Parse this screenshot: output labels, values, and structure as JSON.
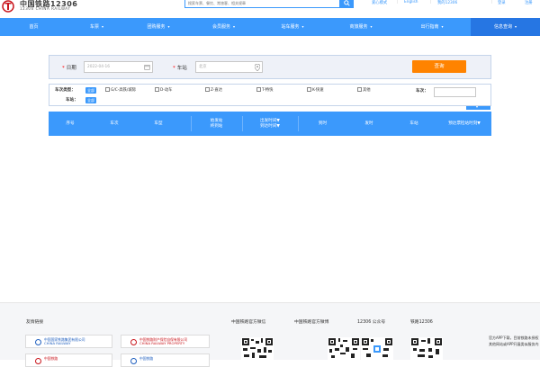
{
  "header": {
    "logo_title": "中国铁路12306",
    "logo_subtitle": "12306 CHINA RAILWAY",
    "search_placeholder": "搜索车票、餐饮、常旅客、相关规章",
    "links": {
      "care": "爱心模式",
      "lang": "English",
      "my": "我的12306",
      "login": "登录",
      "register": "注册"
    }
  },
  "nav": {
    "items": [
      {
        "label": "首页",
        "dropdown": false
      },
      {
        "label": "车票",
        "dropdown": true
      },
      {
        "label": "团购服务",
        "dropdown": true
      },
      {
        "label": "会员服务",
        "dropdown": true
      },
      {
        "label": "站车服务",
        "dropdown": true
      },
      {
        "label": "商旅服务",
        "dropdown": true
      },
      {
        "label": "出行指南",
        "dropdown": true
      },
      {
        "label": "信息查询",
        "dropdown": true
      }
    ],
    "active_index": 7
  },
  "query": {
    "date_label": "日期",
    "date_value": "2022-04-16",
    "station_label": "车站",
    "station_placeholder": "北京",
    "submit_label": "查询"
  },
  "filter": {
    "train_type_label": "车次类型：",
    "train_type_all": "全部",
    "train_types": [
      "G/C-高铁/城际",
      "D-动车",
      "Z-直达",
      "T-特快",
      "K-快速",
      "其他"
    ],
    "station_label": "车站：",
    "station_all": "全部",
    "train_no_label": "车次："
  },
  "table": {
    "headers": [
      "序号",
      "车次",
      "车型",
      "始发站\n终到站",
      "出发时间▼\n到达时间▼",
      "到时",
      "发时",
      "车站",
      "预达票检站时刻▼"
    ]
  },
  "footer": {
    "friend_links_title": "友情链接",
    "partners": [
      {
        "name": "中国国家铁路集团有限公司\nCHINA RAILWAY",
        "color": "#1f5fbf"
      },
      {
        "name": "中国铁路财产保险自保有限公司\nCHINA RAILWAY PROPERTY",
        "color": "#c9161d"
      },
      {
        "name": "中国铁路",
        "color": "#c9161d"
      },
      {
        "name": "中国铁路",
        "color": "#1f5fbf"
      }
    ],
    "qr_titles": [
      "中国铁路官方微信",
      "中国铁路官方微博",
      "12306 公众号",
      "铁路12306"
    ],
    "app_text": "官方APP下载，目前铁路未授权其他网站或APP开展类似服务内"
  }
}
